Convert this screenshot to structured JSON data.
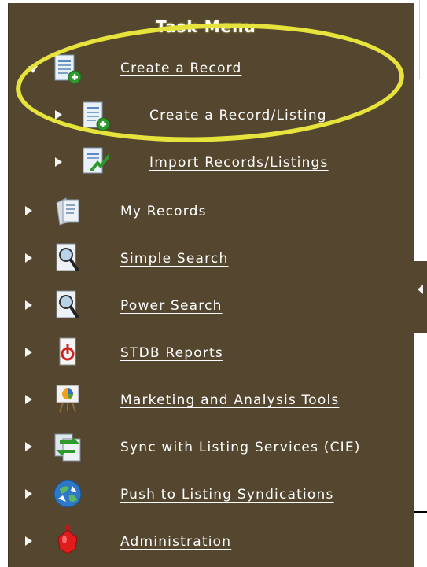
{
  "menu": {
    "title": "Task Menu",
    "items": [
      {
        "label": "Create a Record"
      },
      {
        "label": "Create a Record/Listing"
      },
      {
        "label": "Import Records/Listings"
      },
      {
        "label": "My Records"
      },
      {
        "label": "Simple Search"
      },
      {
        "label": "Power Search"
      },
      {
        "label": "STDB Reports"
      },
      {
        "label": "Marketing and Analysis Tools"
      },
      {
        "label": "Sync with Listing Services (CIE)"
      },
      {
        "label": "Push to Listing Syndications"
      },
      {
        "label": "Administration"
      }
    ]
  },
  "icons": [
    "document-add-icon",
    "document-add-icon",
    "import-document-icon",
    "records-icon",
    "search-magnifier-icon",
    "search-magnifier-icon",
    "report-icon",
    "chart-easel-icon",
    "sync-icon",
    "globe-icon",
    "admin-icon"
  ],
  "colors": {
    "panel": "#55472f",
    "highlight": "#e6e43c",
    "text": "#ffffff"
  }
}
